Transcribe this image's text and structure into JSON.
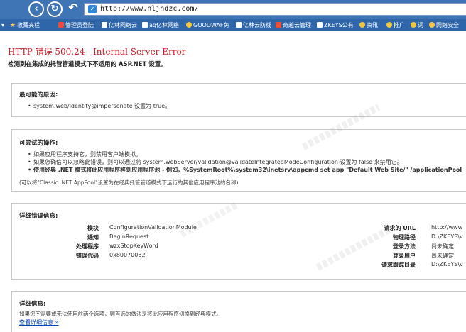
{
  "browser": {
    "url": "http://www.hljhdzc.com/"
  },
  "bookmarks": [
    {
      "label": "收藏夹栏",
      "icon": "folder-icon"
    },
    {
      "label": "管理员登陆",
      "icon": "page-icon"
    },
    {
      "label": "亿林网络云",
      "icon": "page-icon"
    },
    {
      "label": "aq亿林网络",
      "icon": "page-icon"
    },
    {
      "label": "GOODWAF免",
      "icon": "page-icon"
    },
    {
      "label": "亿林云防线",
      "icon": "page-icon"
    },
    {
      "label": "奇越云管理",
      "icon": "page-icon"
    },
    {
      "label": "ZKEYS公有",
      "icon": "page-icon"
    },
    {
      "label": "资讯",
      "icon": "folder-icon"
    },
    {
      "label": "推广",
      "icon": "folder-icon"
    },
    {
      "label": "词",
      "icon": "folder-icon"
    },
    {
      "label": "网络安全",
      "icon": "folder-icon"
    }
  ],
  "error": {
    "title": "HTTP 错误 500.24 - Internal Server Error",
    "subtitle": "检测到在集成的托管管道模式下不适用的 ASP.NET 设置。"
  },
  "causes": {
    "heading": "最可能的原因:",
    "items": [
      "system.web/identity@impersonate 设置为 true。"
    ]
  },
  "actions": {
    "heading": "可尝试的操作:",
    "items": [
      "如果应用程序支持它，则禁用客户端模拟。",
      "如果您确信可以忽略此错误，则可以通过将 system.webServer/validation@validateIntegratedModeConfiguration 设置为 false 来禁用它。",
      "使用经典 .NET 模式将此应用程序移到应用程序池 - 例如，%SystemRoot%\\system32\\inetsrv\\appcmd set app \"Default Web Site/\" /applicationPool"
    ],
    "note": "(可以将\"Classic .NET AppPool\"设置为在经典托管管道模式下运行的其他应用程序池的名称)"
  },
  "details": {
    "heading": "详细错误信息:",
    "left": [
      {
        "key": "模块",
        "value": "ConfigurationValidationModule"
      },
      {
        "key": "通知",
        "value": "BeginRequest"
      },
      {
        "key": "处理程序",
        "value": "wzxStopKeyWord"
      },
      {
        "key": "错误代码",
        "value": "0x80070032"
      }
    ],
    "right": [
      {
        "key": "请求的 URL",
        "value": "http://www"
      },
      {
        "key": "物理路径",
        "value": "D:\\ZKEYS\\v"
      },
      {
        "key": "登录方法",
        "value": "尚未确定"
      },
      {
        "key": "登录用户",
        "value": "尚未确定"
      },
      {
        "key": "请求跟踪目录",
        "value": "D:\\ZKEYS\\v"
      }
    ]
  },
  "more": {
    "heading": "详细信息:",
    "text": "如果您不需要或无法使用前两个选项，则首选的做法是将此应用程序切换到经典模式。",
    "link": "查看详细信息 »"
  }
}
